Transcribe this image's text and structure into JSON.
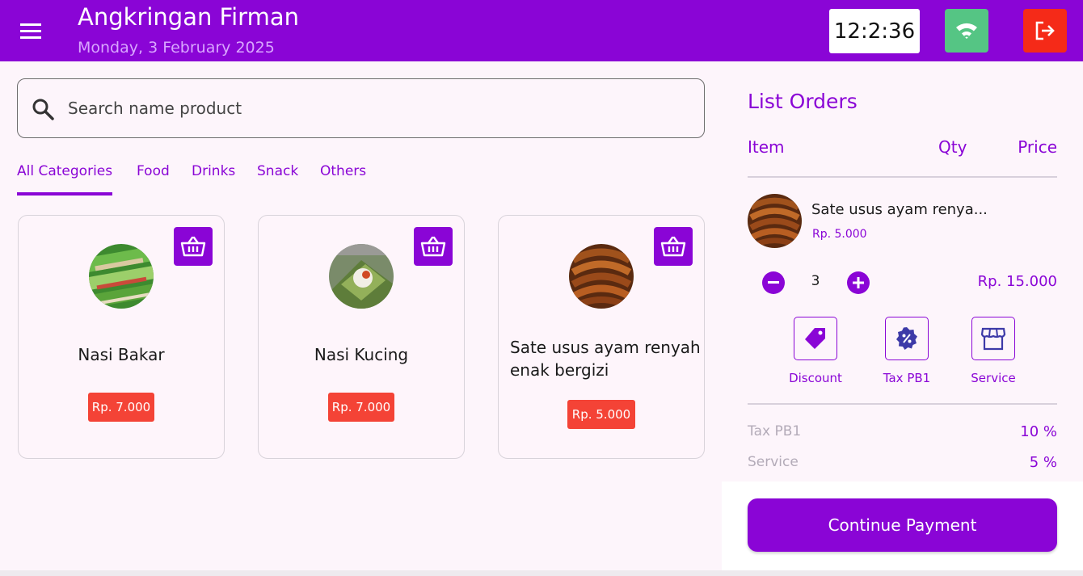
{
  "app": {
    "title": "Angkringan Firman",
    "date": "Monday, 3 February 2025",
    "clock": "12:2:36"
  },
  "colors": {
    "primary": "#8a05d6",
    "price_tag": "#f44336",
    "wifi": "#55c584",
    "logout": "#f52a18"
  },
  "icons": {
    "menu": "menu-icon",
    "wifi": "wifi-icon",
    "logout": "logout-icon",
    "search": "search-icon",
    "cart": "basket-icon"
  },
  "search": {
    "placeholder": "Search name product",
    "value": ""
  },
  "tabs": [
    {
      "label": "All Categories",
      "active": true
    },
    {
      "label": "Food",
      "active": false
    },
    {
      "label": "Drinks",
      "active": false
    },
    {
      "label": "Snack",
      "active": false
    },
    {
      "label": "Others",
      "active": false
    }
  ],
  "products": [
    {
      "name": "Nasi Bakar",
      "price": "Rp. 7.000"
    },
    {
      "name": "Nasi Kucing",
      "price": "Rp. 7.000"
    },
    {
      "name": "Sate usus ayam renyah enak bergizi",
      "price": "Rp. 5.000"
    }
  ],
  "orders": {
    "title": "List Orders",
    "columns": {
      "item": "Item",
      "qty": "Qty",
      "price": "Price"
    },
    "items": [
      {
        "name": "Sate usus ayam renya...",
        "unit_price": "Rp. 5.000",
        "qty": "3",
        "total": "Rp. 15.000"
      }
    ],
    "options": [
      {
        "label": "Discount",
        "icon": "tag-icon"
      },
      {
        "label": "Tax PB1",
        "icon": "percent-badge-icon"
      },
      {
        "label": "Service",
        "icon": "store-icon"
      }
    ],
    "summary": [
      {
        "label": "Tax PB1",
        "value": "10 %"
      },
      {
        "label": "Service",
        "value": "5 %"
      }
    ],
    "pay_label": "Continue Payment"
  }
}
